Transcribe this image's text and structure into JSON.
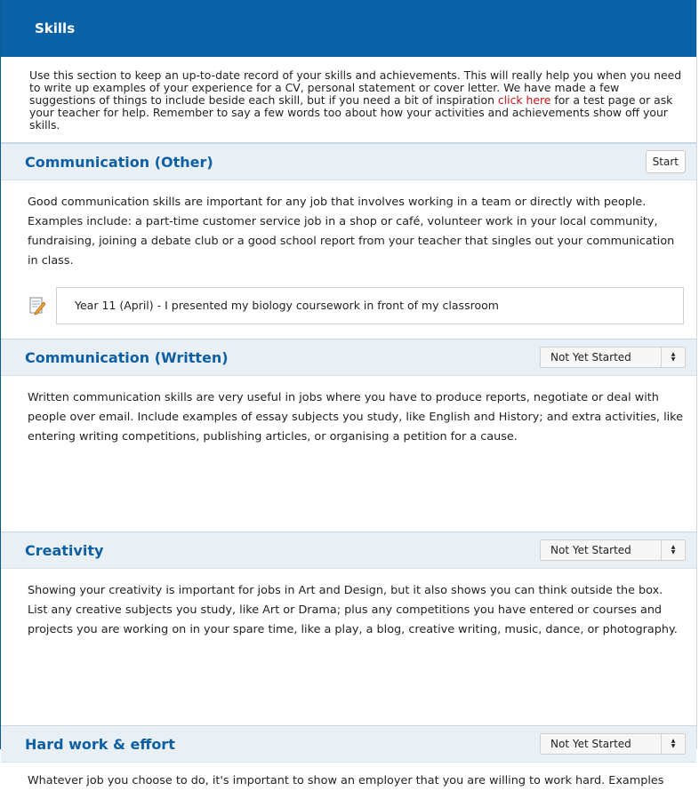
{
  "header": {
    "title": "Skills"
  },
  "intro": {
    "text_before": "Use this section to keep an up-to-date record of your skills and achievements. This will really help you when you need to write up examples of your experience for a CV, personal statement or cover letter. We have made a few suggestions of things to include beside each skill, but if you need a bit of inspiration ",
    "link_label": "click here",
    "text_after": " for a test page or ask your teacher for help. Remember to say a few words too about how your activities and achievements show off your skills.",
    "link_color": "#c4141b"
  },
  "sections": [
    {
      "title": "Communication (Other)",
      "action_label": "Start",
      "description": "Good communication skills are important for any job that involves working in a team or directly with people. Examples include: a part-time customer service job in a shop or café, volunteer work in your local community, fundraising, joining a debate club or a good school report from your teacher that singles out your communication in class.",
      "entry_icon": "note-edit-icon",
      "entry_text": "Year 11 (April) - I presented my biology coursework in front of my classroom"
    },
    {
      "title": "Communication (Written)",
      "status": "Not Yet Started",
      "description": "Written communication skills are very useful in jobs where you have to produce reports, negotiate or deal with people over email. Include examples of essay subjects you study, like English and History; and extra activities, like entering writing competitions, publishing articles, or organising a petition for a cause."
    },
    {
      "title": "Creativity",
      "status": "Not Yet Started",
      "description": "Showing your creativity is important for jobs in Art and Design, but it also shows you can think outside the box. List any creative subjects you study, like Art or Drama; plus any competitions you have entered or courses and projects you are working on in your spare time, like a play, a blog, creative writing, music, dance, or photography."
    },
    {
      "title": "Hard work & effort",
      "status": "Not Yet Started",
      "description": "Whatever job you choose to do, it's important to show an employer that you are willing to work hard. Examples"
    }
  ],
  "colors": {
    "header_bg": "#0b62a6",
    "section_title": "#0f5fa3",
    "section_head_bg": "#e8f0f6"
  }
}
